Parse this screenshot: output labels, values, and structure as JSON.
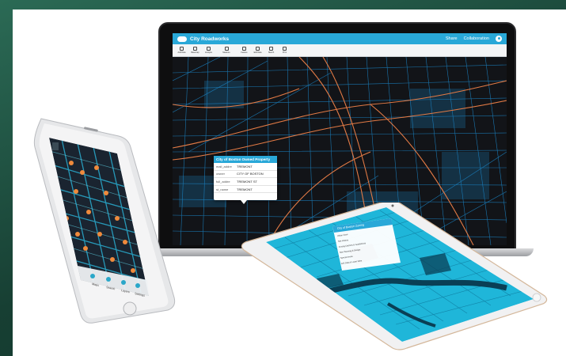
{
  "laptop_app": {
    "title": "City Roadworks",
    "header_links": [
      "Share",
      "Collaboration"
    ],
    "toolbar": [
      "Add Data",
      "Basemap",
      "Analysis",
      "Measure",
      "Feature",
      "Edit Data",
      "Sketch",
      "Print"
    ],
    "popup": {
      "title": "City of Boston Owned Property",
      "rows": [
        {
          "key": "mail_addre",
          "value": "TREMONT"
        },
        {
          "key": "owner",
          "value": "CITY OF BOSTON"
        },
        {
          "key": "full_addre",
          "value": "TREMONT ST"
        },
        {
          "key": "st_name",
          "value": "TREMONT"
        }
      ]
    }
  },
  "phone_app": {
    "tabs": [
      "Maps",
      "Search",
      "Layers",
      "Settings"
    ]
  },
  "tablet_app": {
    "panel_title": "City of Boston Zoning",
    "panel_rows": [
      "Urban Zone",
      "Site History",
      "Zoning Districts & Subdistricts",
      "Site Planning & Design",
      "Special Areas",
      "GIS Data & Layer Files"
    ]
  },
  "colors": {
    "accent": "#29a8d8",
    "map_water": "#1fb6d9",
    "roads_orange": "#e27a45",
    "parcels_blue": "#1b87c9",
    "map_dark": "#121418"
  }
}
